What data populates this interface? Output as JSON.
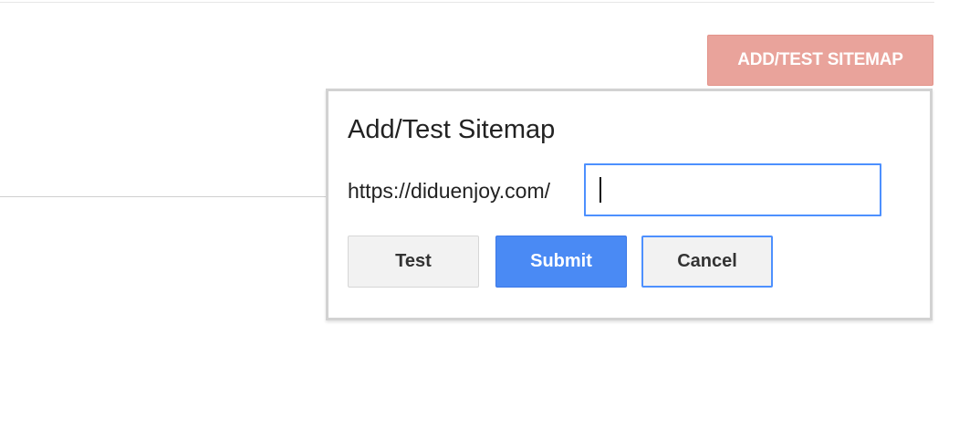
{
  "header": {
    "open_dialog_button_label": "ADD/TEST SITEMAP"
  },
  "dialog": {
    "title": "Add/Test Sitemap",
    "url_prefix": "https://diduenjoy.com/",
    "input": {
      "value": "",
      "placeholder": ""
    },
    "buttons": {
      "test_label": "Test",
      "submit_label": "Submit",
      "cancel_label": "Cancel"
    }
  },
  "colors": {
    "open_button_bg": "#e9a39b",
    "submit_bg": "#4a8af4",
    "focus_border": "#4d90fe",
    "neutral_button_bg": "#f2f2f2"
  }
}
